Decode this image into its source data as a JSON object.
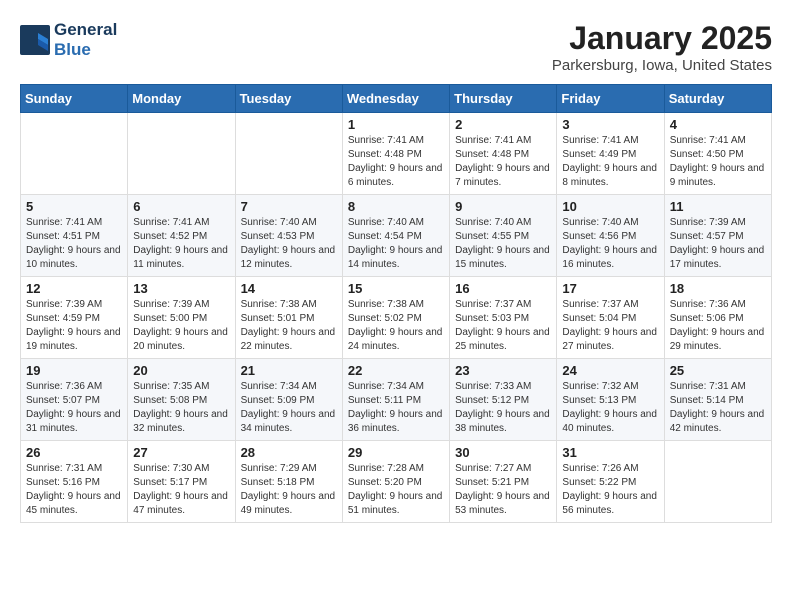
{
  "logo": {
    "line1": "General",
    "line2": "Blue"
  },
  "title": "January 2025",
  "location": "Parkersburg, Iowa, United States",
  "days_of_week": [
    "Sunday",
    "Monday",
    "Tuesday",
    "Wednesday",
    "Thursday",
    "Friday",
    "Saturday"
  ],
  "weeks": [
    [
      {
        "day": "",
        "sunrise": "",
        "sunset": "",
        "daylight": ""
      },
      {
        "day": "",
        "sunrise": "",
        "sunset": "",
        "daylight": ""
      },
      {
        "day": "",
        "sunrise": "",
        "sunset": "",
        "daylight": ""
      },
      {
        "day": "1",
        "sunrise": "Sunrise: 7:41 AM",
        "sunset": "Sunset: 4:48 PM",
        "daylight": "Daylight: 9 hours and 6 minutes."
      },
      {
        "day": "2",
        "sunrise": "Sunrise: 7:41 AM",
        "sunset": "Sunset: 4:48 PM",
        "daylight": "Daylight: 9 hours and 7 minutes."
      },
      {
        "day": "3",
        "sunrise": "Sunrise: 7:41 AM",
        "sunset": "Sunset: 4:49 PM",
        "daylight": "Daylight: 9 hours and 8 minutes."
      },
      {
        "day": "4",
        "sunrise": "Sunrise: 7:41 AM",
        "sunset": "Sunset: 4:50 PM",
        "daylight": "Daylight: 9 hours and 9 minutes."
      }
    ],
    [
      {
        "day": "5",
        "sunrise": "Sunrise: 7:41 AM",
        "sunset": "Sunset: 4:51 PM",
        "daylight": "Daylight: 9 hours and 10 minutes."
      },
      {
        "day": "6",
        "sunrise": "Sunrise: 7:41 AM",
        "sunset": "Sunset: 4:52 PM",
        "daylight": "Daylight: 9 hours and 11 minutes."
      },
      {
        "day": "7",
        "sunrise": "Sunrise: 7:40 AM",
        "sunset": "Sunset: 4:53 PM",
        "daylight": "Daylight: 9 hours and 12 minutes."
      },
      {
        "day": "8",
        "sunrise": "Sunrise: 7:40 AM",
        "sunset": "Sunset: 4:54 PM",
        "daylight": "Daylight: 9 hours and 14 minutes."
      },
      {
        "day": "9",
        "sunrise": "Sunrise: 7:40 AM",
        "sunset": "Sunset: 4:55 PM",
        "daylight": "Daylight: 9 hours and 15 minutes."
      },
      {
        "day": "10",
        "sunrise": "Sunrise: 7:40 AM",
        "sunset": "Sunset: 4:56 PM",
        "daylight": "Daylight: 9 hours and 16 minutes."
      },
      {
        "day": "11",
        "sunrise": "Sunrise: 7:39 AM",
        "sunset": "Sunset: 4:57 PM",
        "daylight": "Daylight: 9 hours and 17 minutes."
      }
    ],
    [
      {
        "day": "12",
        "sunrise": "Sunrise: 7:39 AM",
        "sunset": "Sunset: 4:59 PM",
        "daylight": "Daylight: 9 hours and 19 minutes."
      },
      {
        "day": "13",
        "sunrise": "Sunrise: 7:39 AM",
        "sunset": "Sunset: 5:00 PM",
        "daylight": "Daylight: 9 hours and 20 minutes."
      },
      {
        "day": "14",
        "sunrise": "Sunrise: 7:38 AM",
        "sunset": "Sunset: 5:01 PM",
        "daylight": "Daylight: 9 hours and 22 minutes."
      },
      {
        "day": "15",
        "sunrise": "Sunrise: 7:38 AM",
        "sunset": "Sunset: 5:02 PM",
        "daylight": "Daylight: 9 hours and 24 minutes."
      },
      {
        "day": "16",
        "sunrise": "Sunrise: 7:37 AM",
        "sunset": "Sunset: 5:03 PM",
        "daylight": "Daylight: 9 hours and 25 minutes."
      },
      {
        "day": "17",
        "sunrise": "Sunrise: 7:37 AM",
        "sunset": "Sunset: 5:04 PM",
        "daylight": "Daylight: 9 hours and 27 minutes."
      },
      {
        "day": "18",
        "sunrise": "Sunrise: 7:36 AM",
        "sunset": "Sunset: 5:06 PM",
        "daylight": "Daylight: 9 hours and 29 minutes."
      }
    ],
    [
      {
        "day": "19",
        "sunrise": "Sunrise: 7:36 AM",
        "sunset": "Sunset: 5:07 PM",
        "daylight": "Daylight: 9 hours and 31 minutes."
      },
      {
        "day": "20",
        "sunrise": "Sunrise: 7:35 AM",
        "sunset": "Sunset: 5:08 PM",
        "daylight": "Daylight: 9 hours and 32 minutes."
      },
      {
        "day": "21",
        "sunrise": "Sunrise: 7:34 AM",
        "sunset": "Sunset: 5:09 PM",
        "daylight": "Daylight: 9 hours and 34 minutes."
      },
      {
        "day": "22",
        "sunrise": "Sunrise: 7:34 AM",
        "sunset": "Sunset: 5:11 PM",
        "daylight": "Daylight: 9 hours and 36 minutes."
      },
      {
        "day": "23",
        "sunrise": "Sunrise: 7:33 AM",
        "sunset": "Sunset: 5:12 PM",
        "daylight": "Daylight: 9 hours and 38 minutes."
      },
      {
        "day": "24",
        "sunrise": "Sunrise: 7:32 AM",
        "sunset": "Sunset: 5:13 PM",
        "daylight": "Daylight: 9 hours and 40 minutes."
      },
      {
        "day": "25",
        "sunrise": "Sunrise: 7:31 AM",
        "sunset": "Sunset: 5:14 PM",
        "daylight": "Daylight: 9 hours and 42 minutes."
      }
    ],
    [
      {
        "day": "26",
        "sunrise": "Sunrise: 7:31 AM",
        "sunset": "Sunset: 5:16 PM",
        "daylight": "Daylight: 9 hours and 45 minutes."
      },
      {
        "day": "27",
        "sunrise": "Sunrise: 7:30 AM",
        "sunset": "Sunset: 5:17 PM",
        "daylight": "Daylight: 9 hours and 47 minutes."
      },
      {
        "day": "28",
        "sunrise": "Sunrise: 7:29 AM",
        "sunset": "Sunset: 5:18 PM",
        "daylight": "Daylight: 9 hours and 49 minutes."
      },
      {
        "day": "29",
        "sunrise": "Sunrise: 7:28 AM",
        "sunset": "Sunset: 5:20 PM",
        "daylight": "Daylight: 9 hours and 51 minutes."
      },
      {
        "day": "30",
        "sunrise": "Sunrise: 7:27 AM",
        "sunset": "Sunset: 5:21 PM",
        "daylight": "Daylight: 9 hours and 53 minutes."
      },
      {
        "day": "31",
        "sunrise": "Sunrise: 7:26 AM",
        "sunset": "Sunset: 5:22 PM",
        "daylight": "Daylight: 9 hours and 56 minutes."
      },
      {
        "day": "",
        "sunrise": "",
        "sunset": "",
        "daylight": ""
      }
    ]
  ]
}
